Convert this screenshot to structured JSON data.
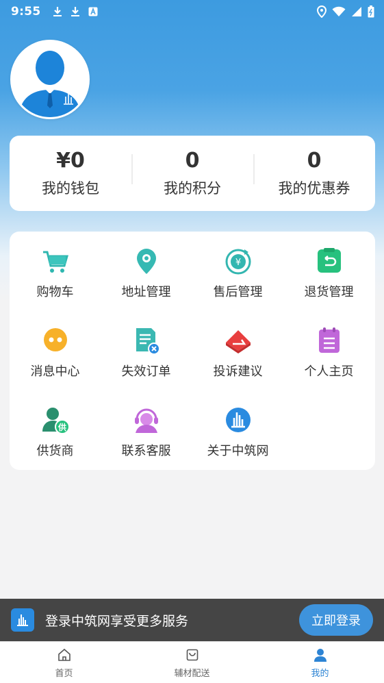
{
  "status_bar": {
    "time": "9:55"
  },
  "stats": [
    {
      "value": "¥0",
      "label": "我的钱包"
    },
    {
      "value": "0",
      "label": "我的积分"
    },
    {
      "value": "0",
      "label": "我的优惠券"
    }
  ],
  "menu": [
    {
      "label": "购物车",
      "icon": "cart-icon"
    },
    {
      "label": "地址管理",
      "icon": "location-icon"
    },
    {
      "label": "售后管理",
      "icon": "after-sales-icon"
    },
    {
      "label": "退货管理",
      "icon": "return-icon"
    },
    {
      "label": "消息中心",
      "icon": "message-icon"
    },
    {
      "label": "失效订单",
      "icon": "invalid-order-icon"
    },
    {
      "label": "投诉建议",
      "icon": "complaint-icon"
    },
    {
      "label": "个人主页",
      "icon": "profile-page-icon"
    },
    {
      "label": "供货商",
      "icon": "supplier-icon"
    },
    {
      "label": "联系客服",
      "icon": "customer-service-icon"
    },
    {
      "label": "关于中筑网",
      "icon": "about-icon"
    }
  ],
  "login_bar": {
    "text": "登录中筑网享受更多服务",
    "button": "立即登录"
  },
  "tabs": [
    {
      "label": "首页",
      "icon": "home-icon"
    },
    {
      "label": "辅材配送",
      "icon": "shopping-bag-icon"
    },
    {
      "label": "我的",
      "icon": "user-icon",
      "active": true
    }
  ],
  "colors": {
    "primary": "#3e93dc",
    "tab_active": "#2d84d4"
  }
}
